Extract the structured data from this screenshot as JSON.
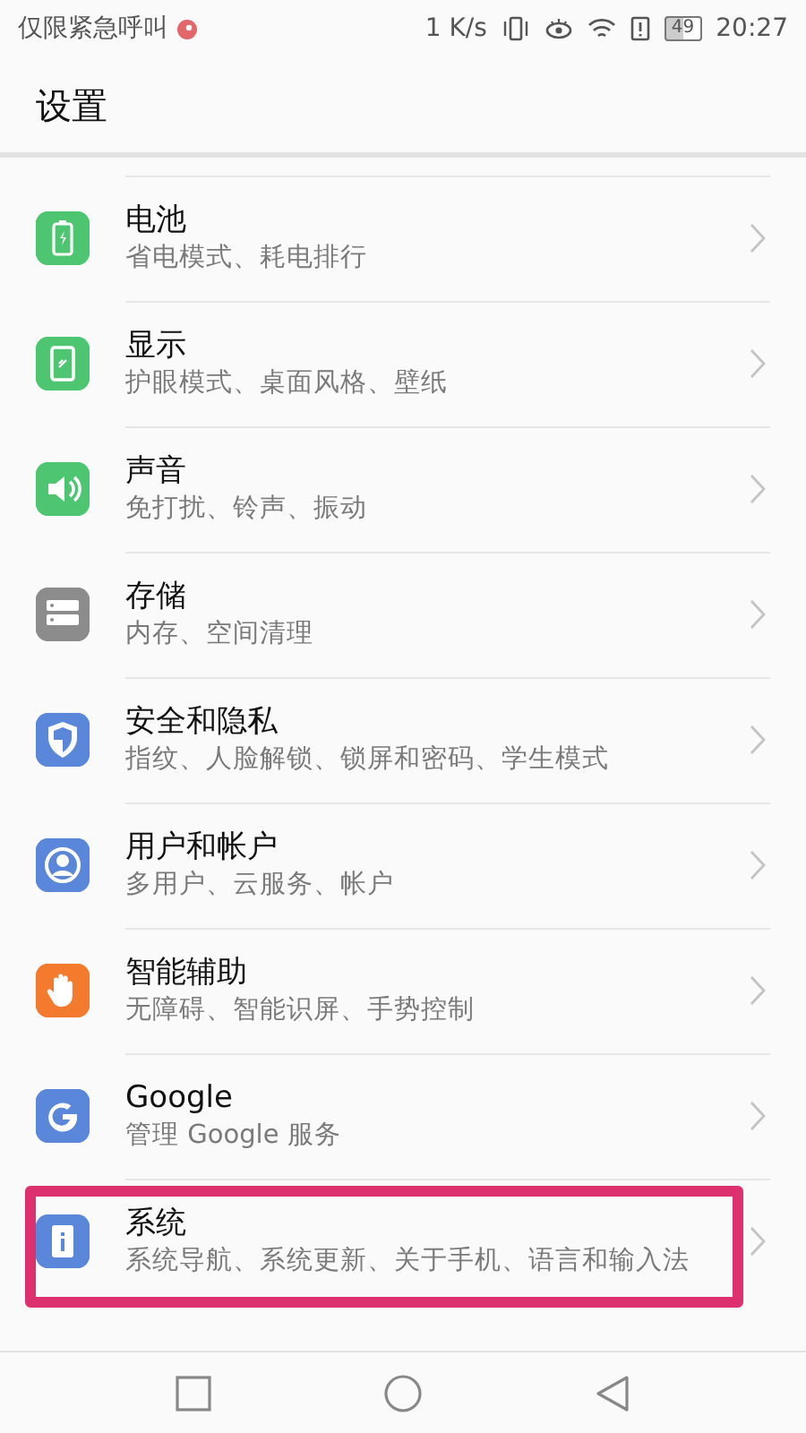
{
  "status_bar": {
    "carrier": "仅限紧急呼叫",
    "speed": "1 K/s",
    "battery": "49",
    "time": "20:27"
  },
  "header": {
    "title": "设置"
  },
  "items": [
    {
      "title": "电池",
      "subtitle": "省电模式、耗电排行",
      "kind": "battery",
      "color": "#4ec671",
      "highlighted": false
    },
    {
      "title": "显示",
      "subtitle": "护眼模式、桌面风格、壁纸",
      "kind": "display",
      "color": "#4ec671",
      "highlighted": false
    },
    {
      "title": "声音",
      "subtitle": "免打扰、铃声、振动",
      "kind": "sound",
      "color": "#4ec671",
      "highlighted": false
    },
    {
      "title": "存储",
      "subtitle": "内存、空间清理",
      "kind": "storage",
      "color": "#8c8c8c",
      "highlighted": false
    },
    {
      "title": "安全和隐私",
      "subtitle": "指纹、人脸解锁、锁屏和密码、学生模式",
      "kind": "shield",
      "color": "#5b87da",
      "highlighted": false
    },
    {
      "title": "用户和帐户",
      "subtitle": "多用户、云服务、帐户",
      "kind": "user",
      "color": "#5b87da",
      "highlighted": false
    },
    {
      "title": "智能辅助",
      "subtitle": "无障碍、智能识屏、手势控制",
      "kind": "hand",
      "color": "#f47a2e",
      "highlighted": false
    },
    {
      "title": "Google",
      "subtitle": "管理 Google 服务",
      "kind": "google",
      "color": "#5b87da",
      "highlighted": false
    },
    {
      "title": "系统",
      "subtitle": "系统导航、系统更新、关于手机、语言和输入法",
      "kind": "info",
      "color": "#5b87da",
      "highlighted": true
    }
  ]
}
